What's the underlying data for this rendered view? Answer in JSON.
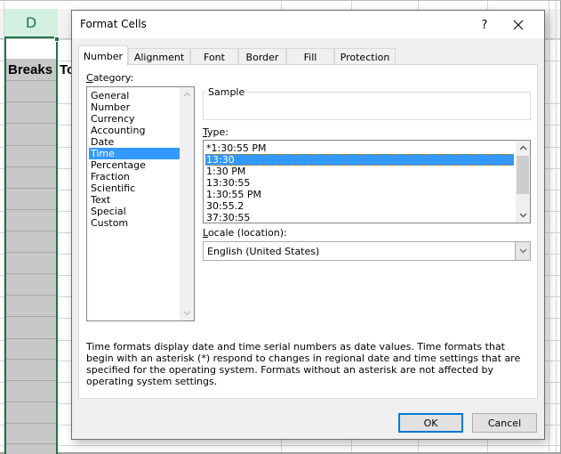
{
  "spreadsheet": {
    "column_header": "D",
    "cells": {
      "breaks": "Breaks",
      "next_cell_partial": "To"
    },
    "accent_color": "#217346"
  },
  "dialog": {
    "title": "Format Cells",
    "help_label": "?",
    "tabs": [
      {
        "label": "Number",
        "active": true
      },
      {
        "label": "Alignment",
        "active": false
      },
      {
        "label": "Font",
        "active": false
      },
      {
        "label": "Border",
        "active": false
      },
      {
        "label": "Fill",
        "active": false
      },
      {
        "label": "Protection",
        "active": false
      }
    ],
    "category": {
      "label_accel": "C",
      "label_rest": "ategory:",
      "items": [
        "General",
        "Number",
        "Currency",
        "Accounting",
        "Date",
        "Time",
        "Percentage",
        "Fraction",
        "Scientific",
        "Text",
        "Special",
        "Custom"
      ],
      "selected": "Time"
    },
    "sample": {
      "label": "Sample",
      "value": ""
    },
    "type": {
      "label_accel": "T",
      "label_rest": "ype:",
      "items": [
        "*1:30:55 PM",
        "13:30",
        "1:30 PM",
        "13:30:55",
        "1:30:55 PM",
        "30:55.2",
        "37:30:55"
      ],
      "selected": "13:30"
    },
    "locale": {
      "label_accel": "L",
      "label_rest": "ocale (location):",
      "value": "English (United States)"
    },
    "description": "Time formats display date and time serial numbers as date values.  Time formats that begin with an asterisk (*) respond to changes in regional date and time settings that are specified for the operating system. Formats without an asterisk are not affected by operating system settings.",
    "buttons": {
      "ok": "OK",
      "cancel": "Cancel"
    },
    "selection_color": "#3399ff",
    "default_button_color": "#0078d7"
  }
}
